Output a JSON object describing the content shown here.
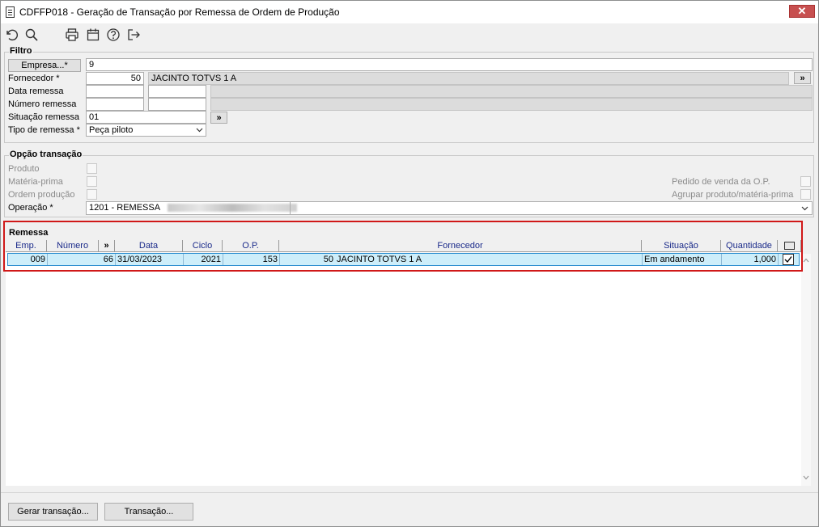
{
  "window": {
    "title": "CDFFP018 - Geração de Transação por Remessa de Ordem de Produção",
    "close_label": "✕"
  },
  "toolbar": {
    "icons": [
      "undo-icon",
      "search-icon",
      "print-icon",
      "calendar-icon",
      "help-icon",
      "exit-icon"
    ]
  },
  "filtro": {
    "title": "Filtro",
    "empresa_button": "Empresa...*",
    "empresa_value": "9",
    "fornecedor_label": "Fornecedor *",
    "fornecedor_code": "50",
    "fornecedor_name": "JACINTO TOTVS 1 A",
    "fornecedor_more": "»",
    "data_remessa_label": "Data remessa",
    "data_remessa_from": "",
    "data_remessa_to": "",
    "numero_remessa_label": "Número remessa",
    "numero_remessa_from": "",
    "numero_remessa_to": "",
    "situacao_label": "Situação remessa",
    "situacao_value": "01",
    "situacao_more": "»",
    "tipo_label": "Tipo de remessa *",
    "tipo_value": "Peça piloto"
  },
  "opcao": {
    "title": "Opção transação",
    "produto_label": "Produto",
    "materia_prima_label": "Matéria-prima",
    "ordem_producao_label": "Ordem produção",
    "pedido_venda_label": "Pedido de venda da O.P.",
    "agrupar_label": "Agrupar produto/matéria-prima",
    "operacao_label": "Operação *",
    "operacao_value": "1201 - REMESSA"
  },
  "remessa": {
    "title": "Remessa",
    "columns": [
      "Emp.",
      "Número",
      "»",
      "Data",
      "Ciclo",
      "O.P.",
      "Fornecedor",
      "Situação",
      "Quantidade"
    ],
    "rows": [
      {
        "emp": "009",
        "numero": "66",
        "data": "31/03/2023",
        "ciclo": "2021",
        "op": "153",
        "forn_code": "50",
        "forn_name": "JACINTO TOTVS 1 A",
        "situacao": "Em andamento",
        "quantidade": "1,000",
        "checked": true
      }
    ]
  },
  "footer": {
    "gerar_label": "Gerar transação...",
    "transacao_label": "Transação..."
  },
  "colors": {
    "highlight": "#d01818",
    "selected_row": "#cdeefa",
    "header_text": "#1a2a8a"
  }
}
